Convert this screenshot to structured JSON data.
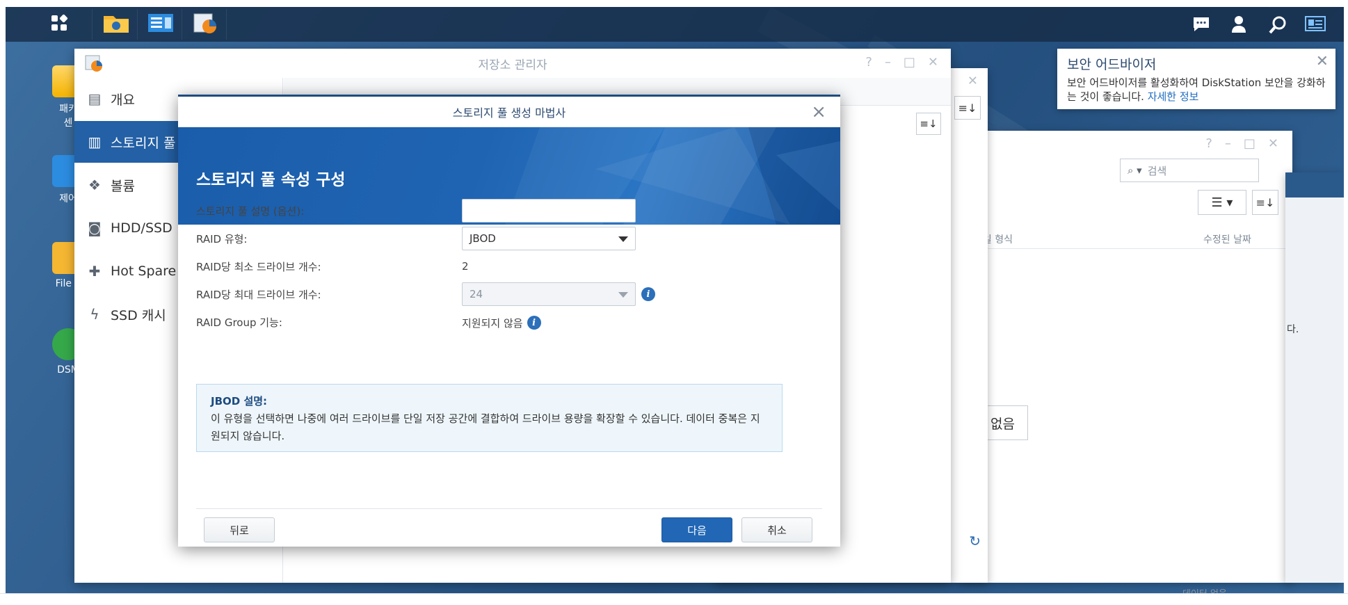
{
  "taskbar": {
    "left_icons": [
      "main-menu-icon",
      "file-station-icon",
      "control-panel-icon",
      "storage-manager-icon"
    ],
    "right_icons": [
      "chat-icon",
      "user-icon",
      "search-icon",
      "widgets-icon"
    ]
  },
  "desktop_icons": [
    {
      "label": "패키\n센",
      "icon": "package-center-icon"
    },
    {
      "label": "제어",
      "icon": "control-panel-icon"
    },
    {
      "label": "File S",
      "icon": "file-station-icon"
    },
    {
      "label": "DSM",
      "icon": "dsm-help-icon"
    }
  ],
  "notification": {
    "title": "보안 어드바이저",
    "body": "보안 어드바이저를 활성화하여 DiskStation 보안을 강화하는 것이 좋습니다.",
    "link": "자세한 정보"
  },
  "storage_manager": {
    "title": "저장소 관리자",
    "sidebar": [
      {
        "label": "개요",
        "icon": "overview-icon"
      },
      {
        "label": "스토리지 풀",
        "icon": "storage-pool-icon"
      },
      {
        "label": "볼륨",
        "icon": "volume-icon"
      },
      {
        "label": "HDD/SSD",
        "icon": "hdd-icon"
      },
      {
        "label": "Hot Spare",
        "icon": "hot-spare-icon"
      },
      {
        "label": "SSD 캐시",
        "icon": "ssd-cache-icon"
      }
    ]
  },
  "file_window": {
    "search_placeholder": "검색",
    "col_type": "파일 형식",
    "col_modified": "수정된 날짜",
    "no_data": "데이터 없음",
    "right_fragment": "다.",
    "empty_fragment": "어 없음"
  },
  "wizard": {
    "title": "스토리지 풀 생성 마법사",
    "banner_title": "스토리지 풀 속성 구성",
    "fields": {
      "description_label": "스토리지 풀 설명 (옵션):",
      "description_value": "",
      "raid_type_label": "RAID 유형:",
      "raid_type_value": "JBOD",
      "min_drives_label": "RAID당 최소 드라이브 개수:",
      "min_drives_value": "2",
      "max_drives_label": "RAID당 최대 드라이브 개수:",
      "max_drives_value": "24",
      "raid_group_label": "RAID Group 기능:",
      "raid_group_value": "지원되지 않음"
    },
    "info_box": {
      "title": "JBOD 설명:",
      "text": "이 유형을 선택하면 나중에 여러 드라이브를 단일 저장 공간에 결합하여 드라이브 용량을 확장할 수 있습니다. 데이터 중복은 지원되지 않습니다."
    },
    "buttons": {
      "back": "뒤로",
      "next": "다음",
      "cancel": "취소"
    }
  }
}
